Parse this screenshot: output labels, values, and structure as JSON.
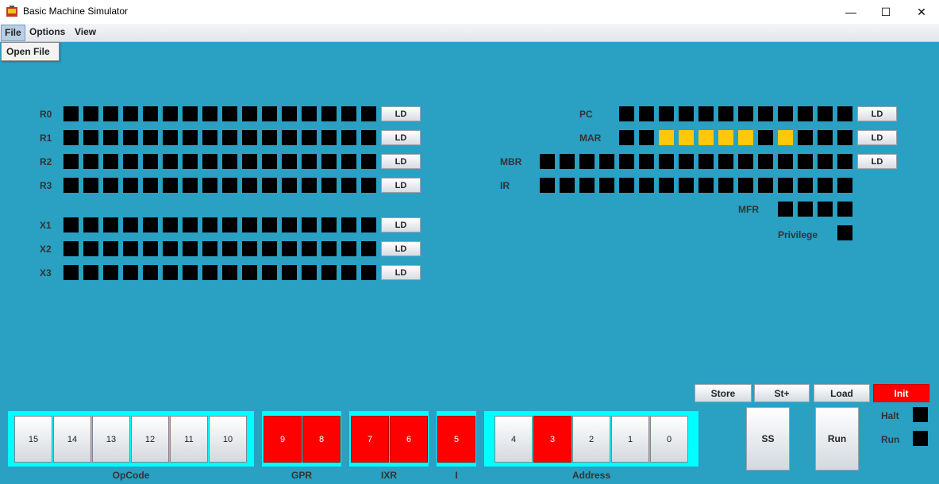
{
  "window": {
    "title": "Basic Machine Simulator",
    "minimize": "—",
    "maximize": "☐",
    "close": "✕"
  },
  "menubar": {
    "items": [
      "File",
      "Options",
      "View"
    ]
  },
  "file_menu": {
    "items": [
      "Open File"
    ]
  },
  "colors": {
    "background": "#2aa0c3",
    "bit_off": "#000000",
    "bit_on": "#ffc80a",
    "switch_on": "#ff0000",
    "group": "#00ffff"
  },
  "registers": {
    "left": [
      {
        "name": "R0",
        "bits": [
          0,
          0,
          0,
          0,
          0,
          0,
          0,
          0,
          0,
          0,
          0,
          0,
          0,
          0,
          0,
          0
        ],
        "button": "LD"
      },
      {
        "name": "R1",
        "bits": [
          0,
          0,
          0,
          0,
          0,
          0,
          0,
          0,
          0,
          0,
          0,
          0,
          0,
          0,
          0,
          0
        ],
        "button": "LD"
      },
      {
        "name": "R2",
        "bits": [
          0,
          0,
          0,
          0,
          0,
          0,
          0,
          0,
          0,
          0,
          0,
          0,
          0,
          0,
          0,
          0
        ],
        "button": "LD"
      },
      {
        "name": "R3",
        "bits": [
          0,
          0,
          0,
          0,
          0,
          0,
          0,
          0,
          0,
          0,
          0,
          0,
          0,
          0,
          0,
          0
        ],
        "button": "LD"
      },
      {
        "name": "X1",
        "bits": [
          0,
          0,
          0,
          0,
          0,
          0,
          0,
          0,
          0,
          0,
          0,
          0,
          0,
          0,
          0,
          0
        ],
        "button": "LD"
      },
      {
        "name": "X2",
        "bits": [
          0,
          0,
          0,
          0,
          0,
          0,
          0,
          0,
          0,
          0,
          0,
          0,
          0,
          0,
          0,
          0
        ],
        "button": "LD"
      },
      {
        "name": "X3",
        "bits": [
          0,
          0,
          0,
          0,
          0,
          0,
          0,
          0,
          0,
          0,
          0,
          0,
          0,
          0,
          0,
          0
        ],
        "button": "LD"
      }
    ],
    "right": [
      {
        "name": "PC",
        "bits": [
          0,
          0,
          0,
          0,
          0,
          0,
          0,
          0,
          0,
          0,
          0,
          0
        ],
        "button": "LD"
      },
      {
        "name": "MAR",
        "bits": [
          0,
          0,
          1,
          1,
          1,
          1,
          1,
          0,
          1,
          0,
          0,
          0
        ],
        "button": "LD"
      },
      {
        "name": "MBR",
        "bits": [
          0,
          0,
          0,
          0,
          0,
          0,
          0,
          0,
          0,
          0,
          0,
          0,
          0,
          0,
          0,
          0
        ],
        "button": "LD"
      },
      {
        "name": "IR",
        "bits": [
          0,
          0,
          0,
          0,
          0,
          0,
          0,
          0,
          0,
          0,
          0,
          0,
          0,
          0,
          0,
          0
        ],
        "button": ""
      },
      {
        "name": "MFR",
        "bits": [
          0,
          0,
          0,
          0
        ],
        "button": ""
      },
      {
        "name": "Privilege",
        "bits": [
          0
        ],
        "button": ""
      }
    ]
  },
  "switches": {
    "groups": [
      {
        "label": "OpCode",
        "switches": [
          {
            "n": "15",
            "on": false
          },
          {
            "n": "14",
            "on": false
          },
          {
            "n": "13",
            "on": false
          },
          {
            "n": "12",
            "on": false
          },
          {
            "n": "11",
            "on": false
          },
          {
            "n": "10",
            "on": false
          }
        ]
      },
      {
        "label": "GPR",
        "switches": [
          {
            "n": "9",
            "on": true
          },
          {
            "n": "8",
            "on": true
          }
        ]
      },
      {
        "label": "IXR",
        "switches": [
          {
            "n": "7",
            "on": true
          },
          {
            "n": "6",
            "on": true
          }
        ]
      },
      {
        "label": "I",
        "switches": [
          {
            "n": "5",
            "on": true
          }
        ]
      },
      {
        "label": "Address",
        "switches": [
          {
            "n": "4",
            "on": false
          },
          {
            "n": "3",
            "on": true
          },
          {
            "n": "2",
            "on": false
          },
          {
            "n": "1",
            "on": false
          },
          {
            "n": "0",
            "on": false
          }
        ]
      }
    ]
  },
  "controls": {
    "store": "Store",
    "store_plus": "St+",
    "load": "Load",
    "init": "Init",
    "ss": "SS",
    "run": "Run",
    "halt_label": "Halt",
    "run_label": "Run"
  }
}
